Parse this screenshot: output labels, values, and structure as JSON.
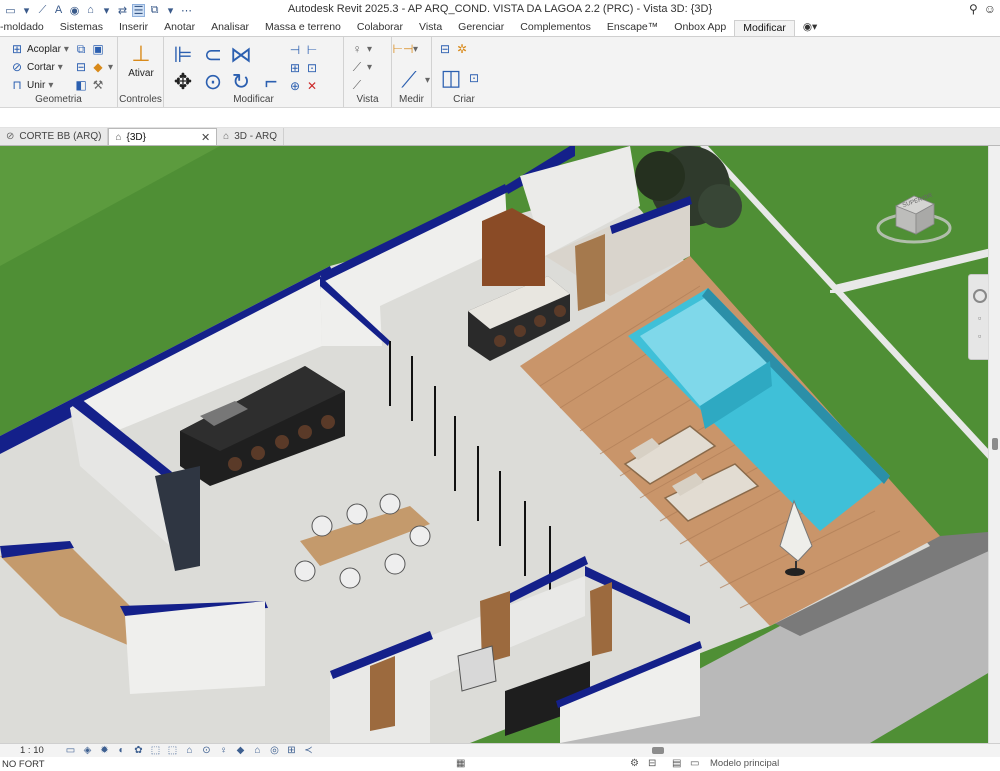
{
  "window": {
    "title": "Autodesk Revit 2025.3 - AP ARQ_COND. VISTA DA LAGOA 2.2 (PRC) - Vista 3D: {3D}"
  },
  "quick_access": [
    "folder-icon",
    "save-icon",
    "undo-icon",
    "measure-icon",
    "home-icon",
    "camera-icon",
    "print-icon",
    "close-icon"
  ],
  "ribbon_tabs": [
    "-moldado",
    "Sistemas",
    "Inserir",
    "Anotar",
    "Analisar",
    "Massa e terreno",
    "Colaborar",
    "Vista",
    "Gerenciar",
    "Complementos",
    "Enscape™",
    "Onbox App",
    "Modificar"
  ],
  "ribbon_active_tab": "Modificar",
  "ribbon_panels": {
    "geometria": {
      "label": "Geometria",
      "acoplar": "Acoplar",
      "cortar": "Cortar",
      "unir": "Unir"
    },
    "controles": {
      "label": "Controles",
      "ativar": "Ativar"
    },
    "modificar": {
      "label": "Modificar"
    },
    "vista": {
      "label": "Vista"
    },
    "medir": {
      "label": "Medir"
    },
    "criar": {
      "label": "Criar"
    }
  },
  "view_tabs": [
    {
      "label": "CORTE BB (ARQ)"
    },
    {
      "label": "{3D}",
      "active": true
    },
    {
      "label": "3D - ARQ"
    }
  ],
  "viewcube": {
    "face_label": "SUPERIOR"
  },
  "view_control_bar": {
    "scale": "1 : 10"
  },
  "status_bar": {
    "left_text": "NO FORT",
    "model": "Modelo principal"
  },
  "colors": {
    "grass": "#4f8f35",
    "wall_cap": "#14208a",
    "wood_deck": "#c9956a",
    "pool_water": "#3fc0d8",
    "floor": "#dcdcd8"
  }
}
